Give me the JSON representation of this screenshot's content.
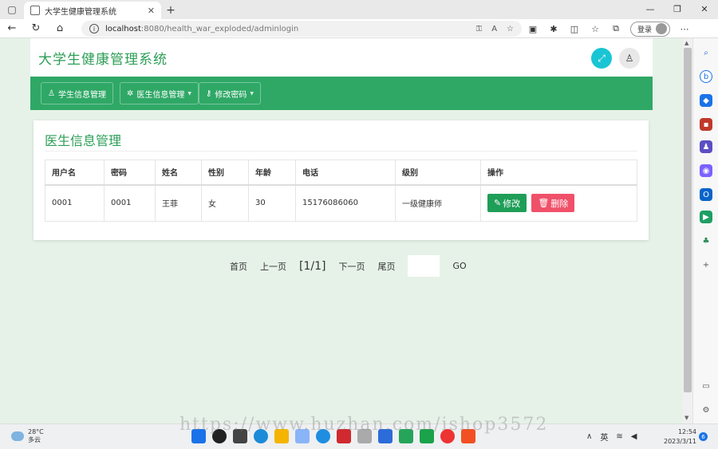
{
  "browser": {
    "tab_title": "大学生健康管理系统",
    "url_host": "localhost",
    "url_rest": ":8080/health_war_exploded/adminlogin",
    "login_label": "登录"
  },
  "site": {
    "title": "大学生健康管理系统",
    "nav": [
      {
        "label": "学生信息管理"
      },
      {
        "label": "医生信息管理"
      },
      {
        "label": "修改密码"
      }
    ]
  },
  "panel": {
    "title": "医生信息管理",
    "columns": [
      "用户名",
      "密码",
      "姓名",
      "性别",
      "年龄",
      "电话",
      "级别",
      "操作"
    ],
    "rows": [
      {
        "username": "0001",
        "password": "0001",
        "name": "王菲",
        "gender": "女",
        "age": "30",
        "phone": "15176086060",
        "level": "一级健康师"
      }
    ],
    "edit_label": "修改",
    "delete_label": "删除"
  },
  "pager": {
    "first": "首页",
    "prev": "上一页",
    "current": "[1/1]",
    "next": "下一页",
    "last": "尾页",
    "go": "GO"
  },
  "taskbar": {
    "temp": "28°C",
    "weather": "多云",
    "ime": "英",
    "time": "12:54",
    "date": "2023/3/11",
    "notif_count": "6"
  },
  "watermark": "https://www.huzhan.com/ishop3572",
  "colors": {
    "brand_green": "#2fa866",
    "edit_green": "#1f9e58",
    "delete_red": "#f0516a",
    "accent_cyan": "#19c5d4"
  }
}
